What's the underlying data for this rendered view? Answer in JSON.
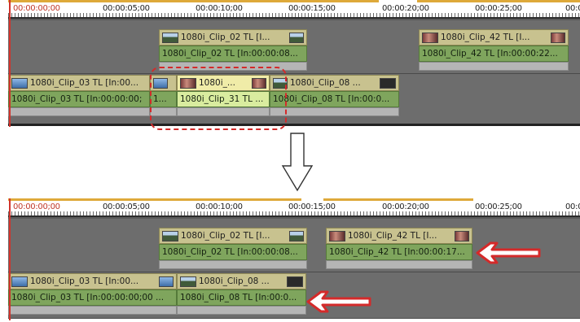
{
  "ruler": {
    "timecodes": [
      "00:00:00;00",
      "00:00:05;00",
      "00:00:10;00",
      "00:00:15;00",
      "00:00:20;00",
      "00:00:25;00",
      "00:00"
    ]
  },
  "before": {
    "track_upper": {
      "clips": [
        {
          "video_label": "1080i_Clip_02  TL [I...",
          "audio_label": "1080i_Clip_02  TL [In:00:00:08..."
        },
        {
          "video_label": "1080i_Clip_42  TL [I...",
          "audio_label": "1080i_Clip_42  TL [In:00:00:22..."
        }
      ]
    },
    "track_lower": {
      "clips": [
        {
          "video_label": "1080i_Clip_03  TL [In:00...",
          "audio_label": "1080i_Clip_03  TL [In:00:00:00;"
        },
        {
          "video_label": "",
          "audio_label": "1..."
        },
        {
          "video_label": "1080i_...",
          "audio_label": "1080i_Clip_31  TL ..."
        },
        {
          "video_label": "1080i_Clip_08  ...",
          "audio_label": "1080i_Clip_08  TL [In:00:0..."
        }
      ]
    }
  },
  "after": {
    "track_upper": {
      "clips": [
        {
          "video_label": "1080i_Clip_02  TL [I...",
          "audio_label": "1080i_Clip_02  TL [In:00:00:08..."
        },
        {
          "video_label": "1080i_Clip_42  TL [I...",
          "audio_label": "1080i_Clip_42  TL [In:00:00:17..."
        }
      ]
    },
    "track_lower": {
      "clips": [
        {
          "video_label": "1080i_Clip_03  TL [In:00...",
          "audio_label": "1080i_Clip_03  TL [In:00:00:00;00 ..."
        },
        {
          "video_label": "1080i_Clip_08  ...",
          "audio_label": "1080i_Clip_08  TL [In:00:0..."
        }
      ]
    }
  },
  "colors": {
    "highlight": "#d42a2a",
    "video_clip": "#c8c28f",
    "audio_clip": "#7fa55d",
    "selected_video": "#f0eca8",
    "selected_audio": "#d9ec9f"
  }
}
